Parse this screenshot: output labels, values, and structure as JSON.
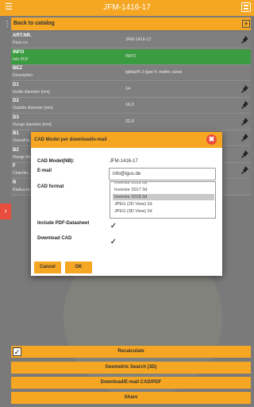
{
  "header": {
    "title": "JFM-1416-17",
    "menu_icon": "menu-icon",
    "mailbox_icon": "inbox-icon"
  },
  "back_bar": {
    "label": "Back to catalog",
    "chevron": "▾"
  },
  "side_arrow": "›",
  "table": {
    "rows": [
      {
        "key": "ART.NR.",
        "desc": "Parts no.",
        "value": "JFM-1416-17",
        "pin": true,
        "highlight": false
      },
      {
        "key": "INFO",
        "desc": "Info PDF",
        "value": "INFO",
        "pin": false,
        "highlight": true
      },
      {
        "key": "BEZ",
        "desc": "Description",
        "value": "iglidur® J type F, metric sizes",
        "pin": false,
        "highlight": false
      },
      {
        "key": "D1",
        "desc": "Inside diameter [mm]",
        "value": "14",
        "pin": true,
        "highlight": false
      },
      {
        "key": "D2",
        "desc": "Outside diameter [mm]",
        "value": "16,0",
        "pin": true,
        "highlight": false
      },
      {
        "key": "D3",
        "desc": "Flange diameter [mm]",
        "value": "22,0",
        "pin": true,
        "highlight": false
      },
      {
        "key": "B1",
        "desc": "Overall le...",
        "value": "",
        "pin": true,
        "highlight": false
      },
      {
        "key": "B2",
        "desc": "Flange thi...",
        "value": "",
        "pin": true,
        "highlight": false
      },
      {
        "key": "F",
        "desc": "Chamfer...",
        "value": "",
        "pin": true,
        "highlight": false
      },
      {
        "key": "R",
        "desc": "Radius m...",
        "value": "",
        "pin": false,
        "highlight": false
      }
    ]
  },
  "bottom": {
    "recalculate": "Recalculate",
    "recalculate_checked": "✓",
    "geometric_search": "Geometric Search (3D)",
    "download": "Download/E-mail CAD/PDF",
    "share": "Share"
  },
  "dialog": {
    "title": "CAD Model per download/e-mail",
    "close": "✖",
    "model_label": "CAD Model(NB):",
    "model_value": "JFM-1416-17",
    "email_label": "E-mail",
    "email_value": "info@igus.de",
    "format_label": "CAD format",
    "formats": [
      "Inventor 2016 3d",
      "Inventor 2017 3d",
      "Inventor 2018 3d",
      "JPEG (2D View) 2d",
      "JPEG (3D View) 2d"
    ],
    "selected_format": "Inventor 2018 3d",
    "pdf_label": "Include PDF-Datasheet",
    "pdf_checked": "✓",
    "download_label": "Download CAD",
    "download_checked": "✓",
    "cancel": "Cancel",
    "ok": "OK"
  },
  "colors": {
    "accent": "#f5a623",
    "highlight_row": "#3a9b40",
    "close_red": "#e84c3d",
    "background": "#7a7a7a"
  }
}
